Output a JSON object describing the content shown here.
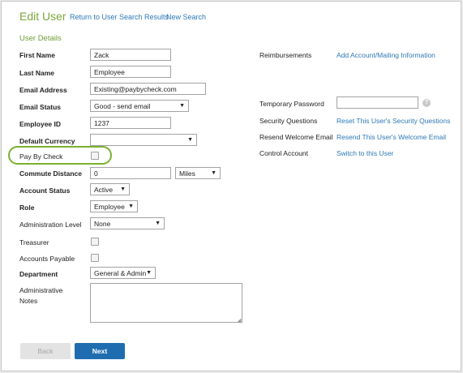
{
  "header": {
    "title": "Edit User",
    "return_link": "Return to User Search Results",
    "new_search_link": "New Search"
  },
  "section_title": "User Details",
  "form": {
    "first_name": {
      "label": "First Name",
      "value": "Zack"
    },
    "last_name": {
      "label": "Last Name",
      "value": "Employee"
    },
    "email": {
      "label": "Email Address",
      "value": "Existing@paybycheck.com"
    },
    "email_status": {
      "label": "Email Status",
      "value": "Good - send email"
    },
    "employee_id": {
      "label": "Employee ID",
      "value": "1237"
    },
    "default_currency": {
      "label": "Default Currency",
      "value": ""
    },
    "pay_by_check": {
      "label": "Pay By Check",
      "checked": false
    },
    "commute_distance": {
      "label": "Commute Distance",
      "value": "0",
      "unit": "Miles"
    },
    "account_status": {
      "label": "Account Status",
      "value": "Active"
    },
    "role": {
      "label": "Role",
      "value": "Employee"
    },
    "admin_level": {
      "label": "Administration Level",
      "value": "None"
    },
    "treasurer": {
      "label": "Treasurer",
      "checked": false
    },
    "accounts_payable": {
      "label": "Accounts Payable",
      "checked": false
    },
    "department": {
      "label": "Department",
      "value": "General & Admin"
    },
    "admin_notes": {
      "label_line1": "Administrative",
      "label_line2": "Notes",
      "value": ""
    }
  },
  "right": {
    "reimbursements": {
      "label": "Reimbursements",
      "link": "Add Account/Mailing Information"
    },
    "temp_password": {
      "label": "Temporary Password",
      "value": "",
      "help": "?"
    },
    "security_questions": {
      "label": "Security Questions",
      "link": "Reset This User's Security Questions"
    },
    "resend_welcome": {
      "label": "Resend Welcome Email",
      "link": "Resend This User's Welcome Email"
    },
    "control_account": {
      "label": "Control Account",
      "link": "Switch to this User"
    }
  },
  "buttons": {
    "back": "Back",
    "next": "Next"
  },
  "colors": {
    "accent_green": "#7aa83c",
    "link_blue": "#2e78b4",
    "next_button": "#1f6db0",
    "highlight_ring": "#7ab22e"
  }
}
